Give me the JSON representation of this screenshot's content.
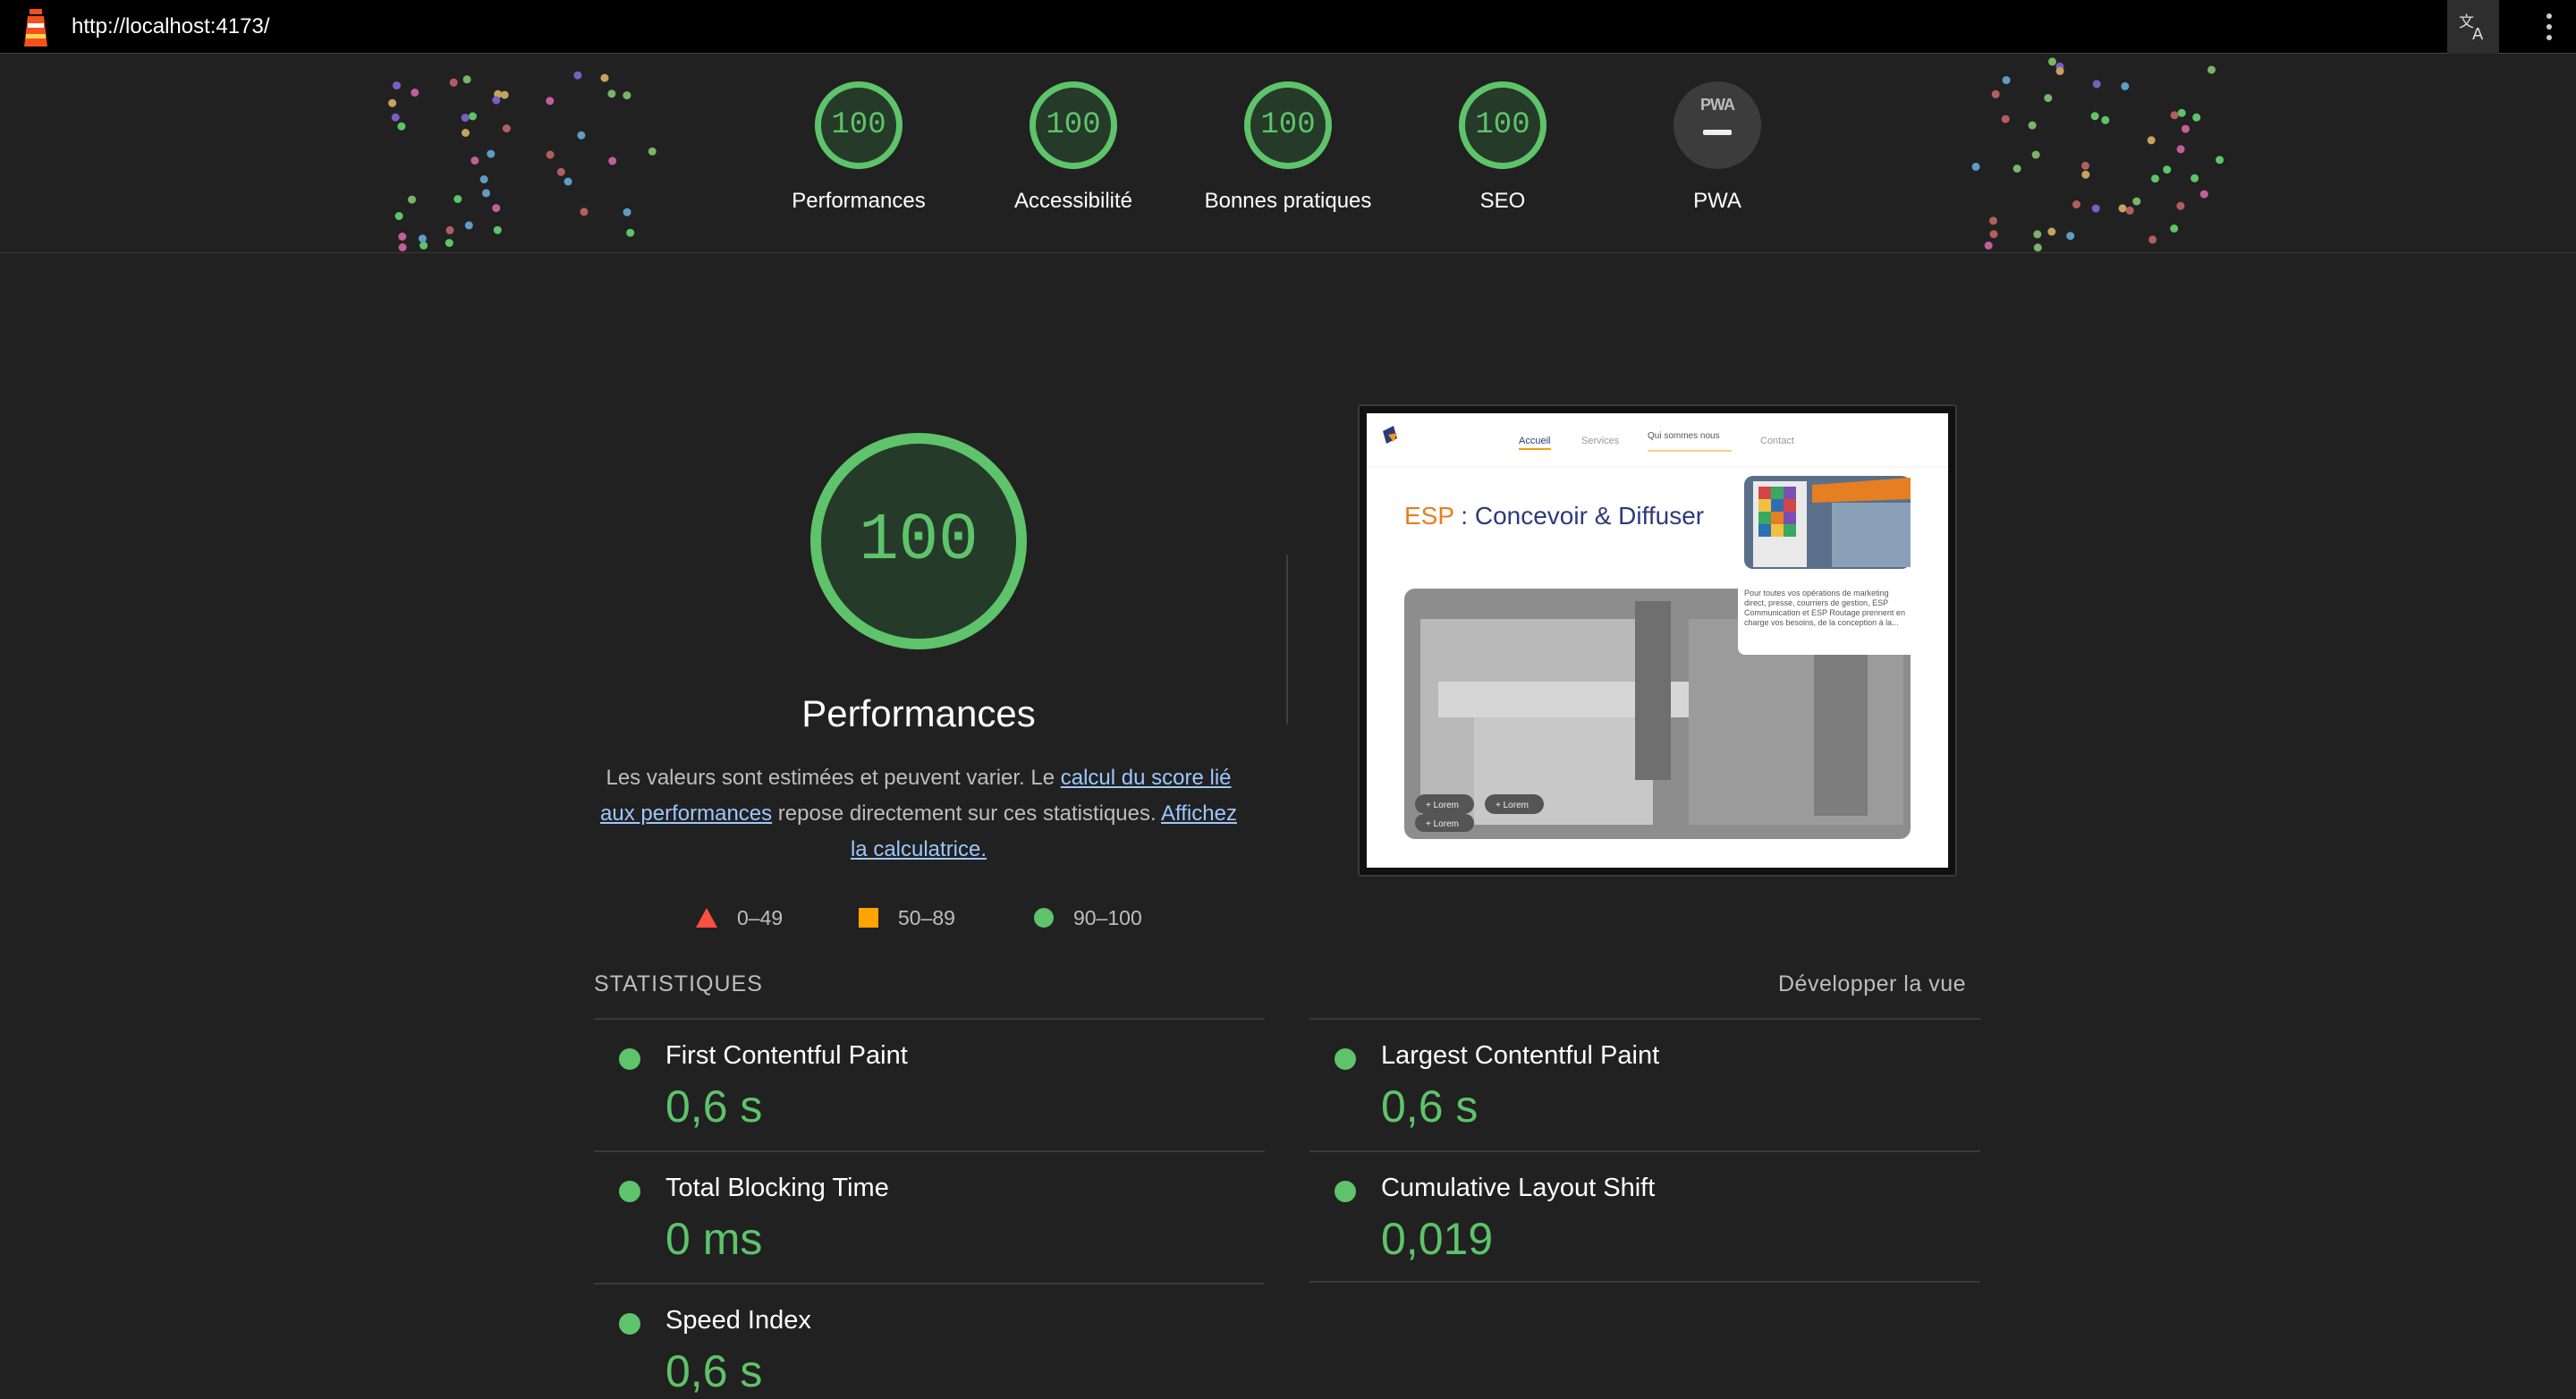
{
  "browser": {
    "url": "http://localhost:4173/"
  },
  "summary": [
    {
      "score": "100",
      "label": "Performances"
    },
    {
      "score": "100",
      "label": "Accessibilité"
    },
    {
      "score": "100",
      "label": "Bonnes pratiques"
    },
    {
      "score": "100",
      "label": "SEO"
    },
    {
      "score": "PWA",
      "label": "PWA"
    }
  ],
  "main": {
    "score": "100",
    "title": "Performances",
    "desc_1": "Les valeurs sont estimées et peuvent varier. Le ",
    "link_1": "calcul du score lié aux performances",
    "desc_2": " repose directement sur ces statistiques. ",
    "link_2": "Affichez la calculatrice."
  },
  "legend": {
    "fail": "0–49",
    "average": "50–89",
    "pass": "90–100"
  },
  "colors": {
    "pass": "#5ec36a",
    "average": "#ffa400",
    "fail": "#ff4e42",
    "background": "#212121"
  },
  "screenshot": {
    "nav": [
      "Accueil",
      "Services",
      "Qui sommes nous",
      "Contact"
    ],
    "heading_brand": "ESP",
    "heading_rest": " : Concevoir & Diffuser",
    "paragraph": "Pour toutes vos opérations de marketing direct, presse, courriers de gestion, ESP Communication et ESP Routage prennent en charge vos besoins, de la conception à la...",
    "chips": [
      "+ Lorem",
      "+ Lorem",
      "+ Lorem"
    ]
  },
  "stats": {
    "header": "STATISTIQUES",
    "expand": "Développer la vue",
    "metrics": [
      {
        "name": "First Contentful Paint",
        "value": "0,6 s"
      },
      {
        "name": "Largest Contentful Paint",
        "value": "0,6 s"
      },
      {
        "name": "Total Blocking Time",
        "value": "0 ms"
      },
      {
        "name": "Cumulative Layout Shift",
        "value": "0,019"
      },
      {
        "name": "Speed Index",
        "value": "0,6 s"
      }
    ]
  }
}
